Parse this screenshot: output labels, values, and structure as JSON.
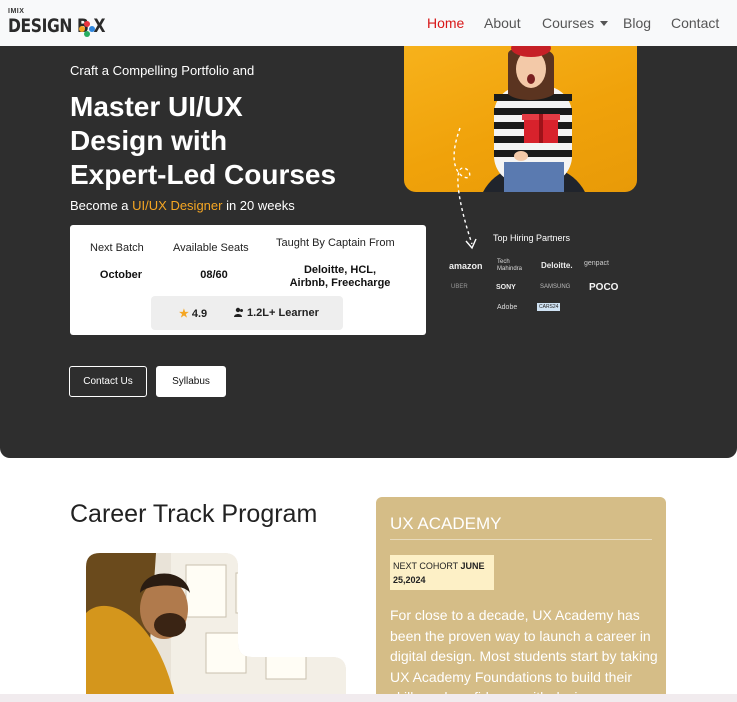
{
  "nav": {
    "logo_top": "IMIX",
    "logo_main": "DESIGN B  X",
    "links": [
      "Home",
      "About",
      "Courses",
      "Blog",
      "Contact"
    ]
  },
  "hero": {
    "kicker": "Craft a Compelling Portfolio and",
    "headline": [
      "Master UI/UX",
      "Design with",
      "Expert-Led Courses"
    ],
    "sub_prefix": "Become a ",
    "sub_accent": "UI/UX Designer",
    "sub_suffix": " in 20 weeks",
    "card": {
      "next_batch_label": "Next Batch",
      "next_batch_value": "October",
      "seats_label": "Available Seats",
      "seats_value": "08/60",
      "taught_label": "Taught By Captain From",
      "taught_value_1": "Deloitte, HCL,",
      "taught_value_2": "Airbnb, Freecharge",
      "rating": "4.9",
      "learners": "1.2L+ Learner"
    },
    "buttons": {
      "contact": "Contact Us",
      "syllabus": "Syllabus"
    },
    "partners_title": "Top Hiring Partners",
    "partners": [
      "amazon",
      "Tech Mahindra",
      "Deloitte.",
      "genpact",
      "UBER",
      "SONY",
      "SAMSUNG",
      "POCO",
      "Adobe",
      "CARS24"
    ]
  },
  "career": {
    "title": "Career Track Program"
  },
  "academy": {
    "title": "UX ACADEMY",
    "cohort_prefix": "NEXT COHORT ",
    "cohort_date_1": "JUNE",
    "cohort_date_2": "25,2024",
    "body": "For close to a decade, UX Academy has been the proven way to launch a career in digital design. Most students start by taking UX Academy Foundations to build their skills and confidence with design"
  },
  "colors": {
    "hero_bg": "#2e2e2e",
    "accent_orange": "#f5a623",
    "nav_active": "#d81818",
    "academy_bg": "#d5bd87",
    "cohort_bg": "#fdf0c6"
  }
}
